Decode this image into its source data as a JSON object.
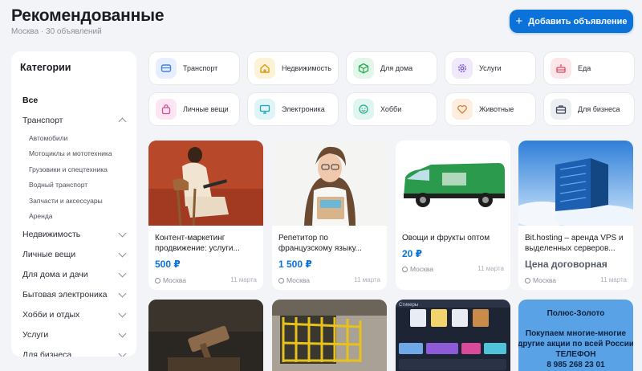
{
  "header": {
    "title": "Рекомендованные",
    "subtitle": "Москва · 30 объявлений",
    "add_button": "Добавить объявление"
  },
  "sidebar": {
    "title": "Категории",
    "items": [
      {
        "label": "Все"
      },
      {
        "label": "Транспорт"
      },
      {
        "label": "Автомобили"
      },
      {
        "label": "Мотоциклы и мототехника"
      },
      {
        "label": "Грузовики и спецтехника"
      },
      {
        "label": "Водный транспорт"
      },
      {
        "label": "Запчасти и аксессуары"
      },
      {
        "label": "Аренда"
      },
      {
        "label": "Недвижимость"
      },
      {
        "label": "Личные вещи"
      },
      {
        "label": "Для дома и дачи"
      },
      {
        "label": "Бытовая электроника"
      },
      {
        "label": "Хобби и отдых"
      },
      {
        "label": "Услуги"
      },
      {
        "label": "Для бизнеса"
      }
    ]
  },
  "categories": [
    {
      "label": "Транспорт",
      "icon": "car-icon",
      "color": "#4a7fe0"
    },
    {
      "label": "Недвижимость",
      "icon": "house-icon",
      "color": "#d99a16"
    },
    {
      "label": "Для дома",
      "icon": "box-icon",
      "color": "#2aa854"
    },
    {
      "label": "Услуги",
      "icon": "gear-icon",
      "color": "#7d5bd6"
    },
    {
      "label": "Еда",
      "icon": "cake-icon",
      "color": "#d94b63"
    },
    {
      "label": "Личные вещи",
      "icon": "bag-icon",
      "color": "#d94b9a"
    },
    {
      "label": "Электроника",
      "icon": "monitor-icon",
      "color": "#1aa4b8"
    },
    {
      "label": "Хобби",
      "icon": "smile-icon",
      "color": "#2aa88a"
    },
    {
      "label": "Животные",
      "icon": "heart-icon",
      "color": "#e07a2e"
    },
    {
      "label": "Для бизнеса",
      "icon": "briefcase-icon",
      "color": "#3b4252"
    }
  ],
  "listings": [
    {
      "title": "Контент-маркетинг продвижение: услуги...",
      "price": "500 ₽",
      "location": "Москва",
      "date": "11 марта"
    },
    {
      "title": "Репетитор по французскому языку...",
      "price": "1 500 ₽",
      "location": "Москва",
      "date": "11 марта"
    },
    {
      "title": "Овощи и фрукты оптом",
      "price": "20 ₽",
      "location": "Москва",
      "date": "11 марта"
    },
    {
      "title": "Bit.hosting – аренда VPS и выделенных серверов...",
      "price": "Цена договорная",
      "location": "Москва",
      "date": "11 марта"
    }
  ],
  "row2": {
    "card4_lines": [
      "Полюс-Золото",
      "Покупаем многие-многие",
      "другие акции по всей России",
      "ТЕЛЕФОН",
      "8 985 268 23 01"
    ],
    "card3_header": "Стикеры"
  },
  "colors": {
    "accent": "#0a72d9",
    "background": "#f3f4f7"
  }
}
